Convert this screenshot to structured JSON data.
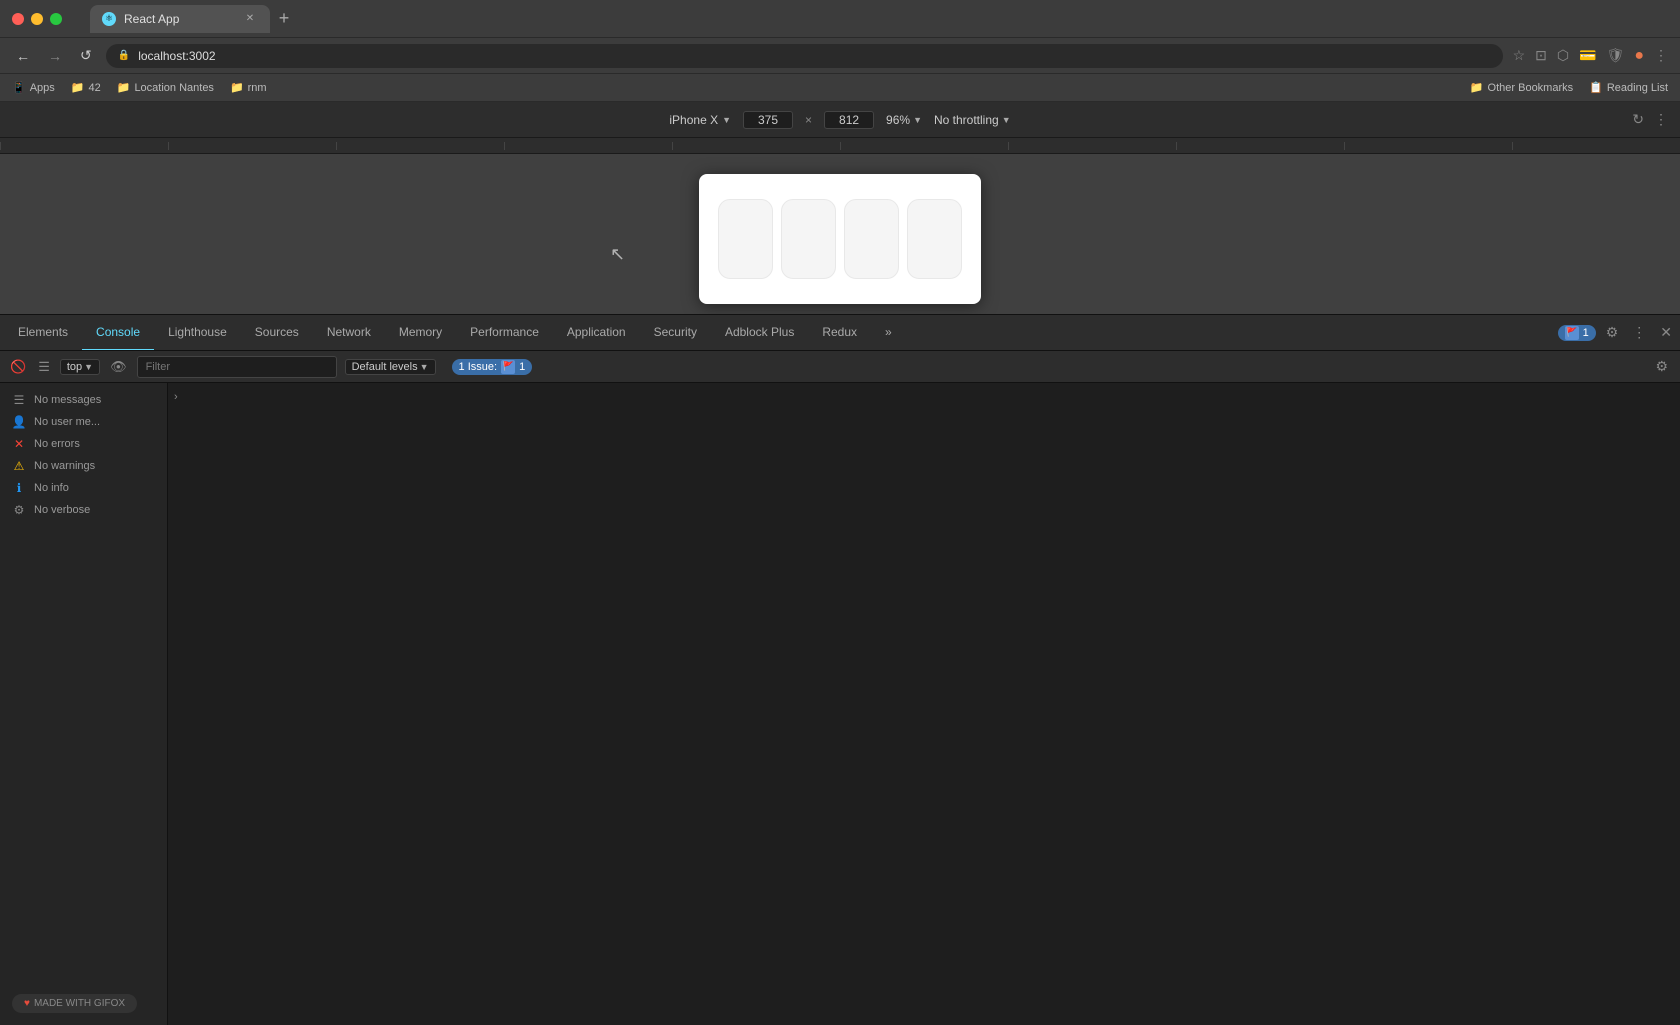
{
  "titleBar": {
    "tabTitle": "React App",
    "newTabTitle": "+"
  },
  "navBar": {
    "url": "localhost:3002",
    "backLabel": "←",
    "forwardLabel": "→",
    "reloadLabel": "↺"
  },
  "bookmarksBar": {
    "items": [
      {
        "icon": "📱",
        "label": "Apps"
      },
      {
        "icon": "📁",
        "label": "42"
      },
      {
        "icon": "📁",
        "label": "Location Nantes"
      },
      {
        "icon": "📁",
        "label": "rnm"
      }
    ],
    "rightItems": [
      {
        "label": "Other Bookmarks"
      },
      {
        "label": "Reading List"
      }
    ]
  },
  "deviceBar": {
    "deviceName": "iPhone X",
    "width": "375",
    "height": "812",
    "zoom": "96%",
    "throttle": "No throttling"
  },
  "devtools": {
    "tabs": [
      {
        "label": "Elements",
        "active": false
      },
      {
        "label": "Console",
        "active": true
      },
      {
        "label": "Lighthouse",
        "active": false
      },
      {
        "label": "Sources",
        "active": false
      },
      {
        "label": "Network",
        "active": false
      },
      {
        "label": "Memory",
        "active": false
      },
      {
        "label": "Performance",
        "active": false
      },
      {
        "label": "Application",
        "active": false
      },
      {
        "label": "Security",
        "active": false
      },
      {
        "label": "Adblock Plus",
        "active": false
      },
      {
        "label": "Redux",
        "active": false
      }
    ],
    "issueCount": "1",
    "issueLabel": "1 Issue:",
    "tabCount": "1"
  },
  "consoleToolbar": {
    "contextLabel": "top",
    "filterPlaceholder": "Filter",
    "levelsLabel": "Default levels",
    "issueText": "1 Issue:",
    "issueNum": "1"
  },
  "consoleSidebar": {
    "items": [
      {
        "icon": "list",
        "label": "No messages",
        "iconChar": "☰"
      },
      {
        "icon": "user",
        "label": "No user me...",
        "iconChar": "👤"
      },
      {
        "icon": "error",
        "label": "No errors",
        "iconChar": "✕"
      },
      {
        "icon": "warning",
        "label": "No warnings",
        "iconChar": "⚠"
      },
      {
        "icon": "info",
        "label": "No info",
        "iconChar": "ℹ"
      },
      {
        "icon": "verbose",
        "label": "No verbose",
        "iconChar": "⚙"
      }
    ]
  },
  "gifoxBadge": {
    "label": "MADE WITH GIFOX",
    "icon": "♥"
  }
}
